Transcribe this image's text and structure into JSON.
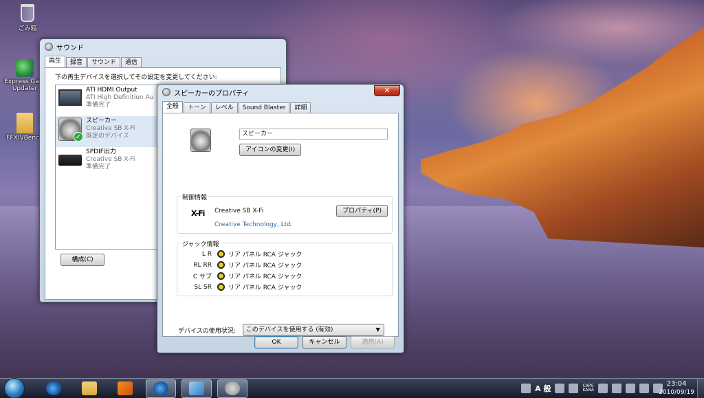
{
  "desktop": {
    "icons": [
      {
        "label": "ごみ箱"
      },
      {
        "label": "Express Gate Updater"
      },
      {
        "label": "FFXIVBench"
      }
    ]
  },
  "sound_window": {
    "title": "サウンド",
    "tabs": [
      "再生",
      "録音",
      "サウンド",
      "通信"
    ],
    "instruction": "下の再生デバイスを選択してその設定を変更してください:",
    "devices": [
      {
        "name": "ATI HDMI Output",
        "driver": "ATI High Definition Au",
        "status": "準備完了",
        "icon": "monitor-icon"
      },
      {
        "name": "スピーカー",
        "driver": "Creative SB X-Fi",
        "status": "既定のデバイス",
        "icon": "speaker-icon"
      },
      {
        "name": "SPDIF出力",
        "driver": "Creative SB X-Fi",
        "status": "準備完了",
        "icon": "spdif-icon"
      }
    ],
    "configure_label": "構成(C)"
  },
  "props_window": {
    "title": "スピーカーのプロパティ",
    "close_label": "✕",
    "tabs": [
      "全般",
      "トーン",
      "レベル",
      "Sound Blaster",
      "詳細"
    ],
    "device_name": "スピーカー",
    "change_icon_label": "アイコンの変更(I)",
    "controller": {
      "section_label": "制御情報",
      "logo": "X-Fi",
      "name": "Creative SB X-Fi",
      "vendor": "Creative Technology, Ltd.",
      "properties_label": "プロパティ(P)"
    },
    "jack": {
      "section_label": "ジャック情報",
      "rows": [
        {
          "channel": "L R",
          "location": "リア パネル RCA ジャック"
        },
        {
          "channel": "RL RR",
          "location": "リア パネル RCA ジャック"
        },
        {
          "channel": "C サブ",
          "location": "リア パネル RCA ジャック"
        },
        {
          "channel": "SL SR",
          "location": "リア パネル RCA ジャック"
        }
      ]
    },
    "usage": {
      "label": "デバイスの使用状況:",
      "value": "このデバイスを使用する (有効)"
    },
    "buttons": {
      "ok": "OK",
      "cancel": "キャンセル",
      "apply": "適用(A)"
    }
  },
  "taskbar": {
    "ime_label": "A 般",
    "caps_label": "CAPS",
    "kana_label": "KANA",
    "time": "23:04",
    "date": "2010/09/19"
  }
}
